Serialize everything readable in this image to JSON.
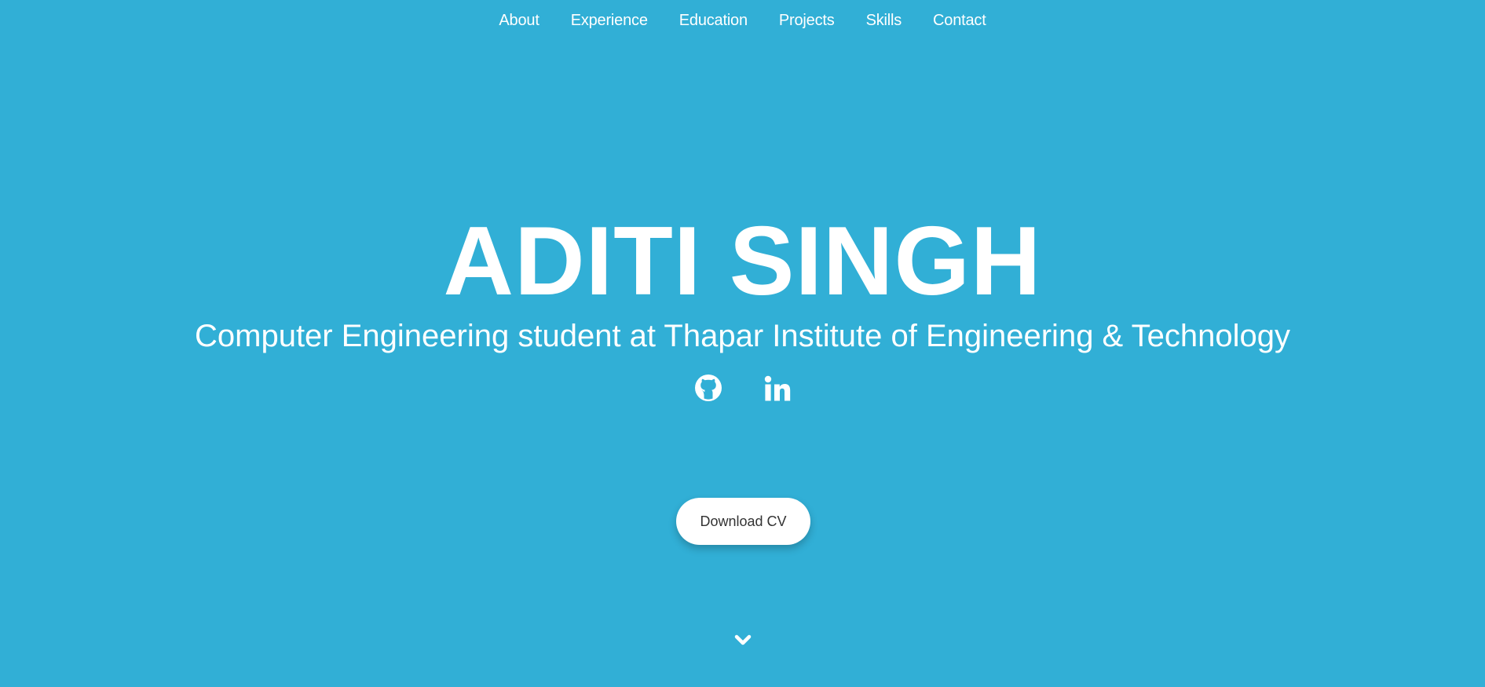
{
  "nav": {
    "items": [
      {
        "label": "About"
      },
      {
        "label": "Experience"
      },
      {
        "label": "Education"
      },
      {
        "label": "Projects"
      },
      {
        "label": "Skills"
      },
      {
        "label": "Contact"
      }
    ]
  },
  "hero": {
    "name": "ADITI SINGH",
    "subtitle": "Computer Engineering student at Thapar Institute of Engineering & Technology",
    "download_label": "Download CV"
  },
  "social": [
    {
      "icon": "github-icon"
    },
    {
      "icon": "linkedin-icon"
    }
  ],
  "scroll": {
    "icon": "chevron-down-icon"
  },
  "colors": {
    "background": "#31afd6",
    "text": "#ffffff",
    "button_bg": "#ffffff",
    "button_text": "#333333"
  }
}
